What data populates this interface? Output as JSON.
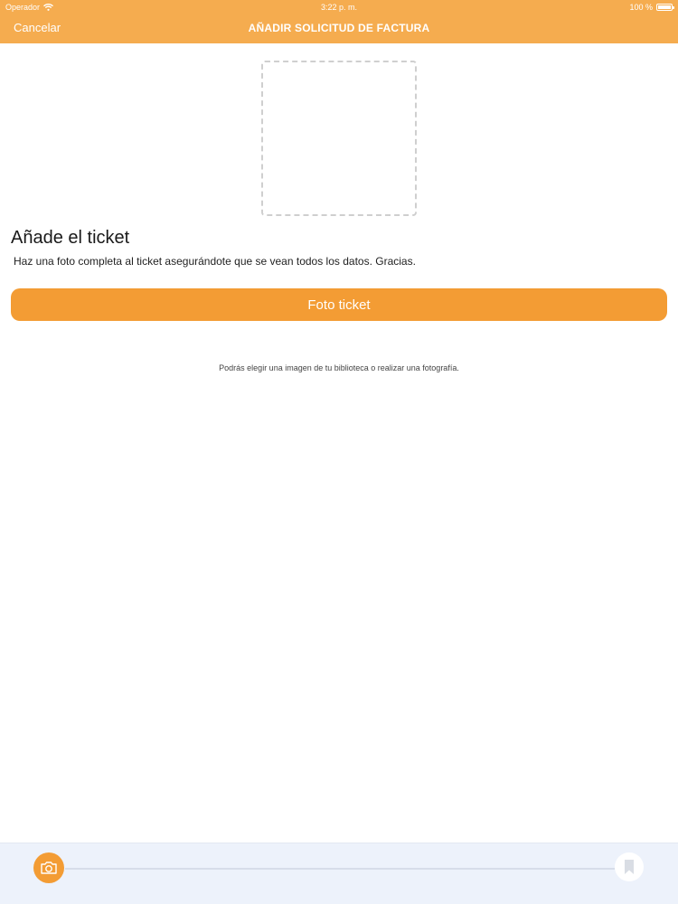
{
  "status_bar": {
    "carrier": "Operador",
    "time": "3:22 p. m.",
    "battery": "100 %"
  },
  "nav": {
    "cancel_label": "Cancelar",
    "title": "AÑADIR SOLICITUD DE FACTURA"
  },
  "content": {
    "section_title": "Añade el ticket",
    "description": "Haz una foto completa al ticket asegurándote que se vean todos los datos. Gracias.",
    "photo_button_label": "Foto ticket",
    "hint": "Podrás elegir una imagen de tu biblioteca o realizar una fotografía."
  },
  "progress": {
    "steps": [
      {
        "icon": "camera-icon",
        "active": true
      },
      {
        "icon": "bookmark-icon",
        "active": false
      }
    ]
  },
  "colors": {
    "header": "#f5ac4f",
    "accent": "#f39c34",
    "bottom_bar": "#edf2fb"
  }
}
